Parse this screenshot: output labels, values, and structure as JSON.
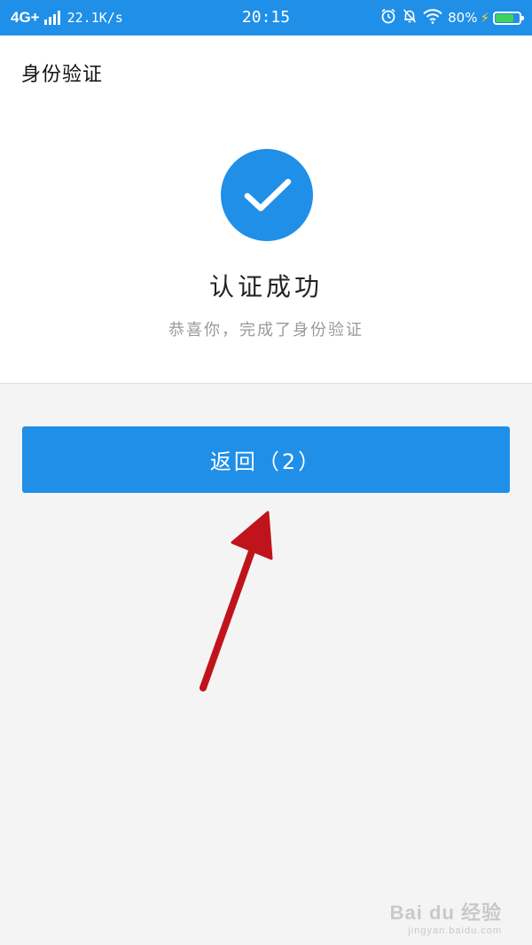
{
  "status_bar": {
    "network": "4G+",
    "speed": "22.1K/s",
    "time": "20:15",
    "battery_percent": "80%",
    "battery_level": 0.8,
    "icons": [
      "alarm-icon",
      "bell-off-icon",
      "wifi-icon",
      "charging-bolt-icon",
      "battery-icon"
    ]
  },
  "header": {
    "title": "身份验证"
  },
  "result": {
    "icon": "check-icon",
    "title": "认证成功",
    "description": "恭喜你，完成了身份验证"
  },
  "actions": {
    "back_label": "返回（2）"
  },
  "watermark": {
    "main": "Bai du 经验",
    "sub": "jingyan.baidu.com"
  },
  "colors": {
    "primary": "#1f8fe8",
    "background": "#f4f4f4",
    "card": "#ffffff",
    "annotation_arrow": "#c0141c",
    "battery_fill": "#3dd25c"
  }
}
